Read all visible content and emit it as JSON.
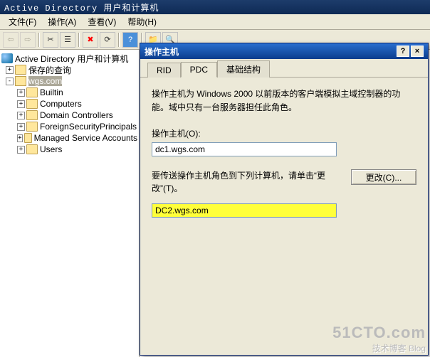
{
  "window": {
    "title": "Active Directory 用户和计算机"
  },
  "menu": {
    "file": "文件(F)",
    "action": "操作(A)",
    "view": "查看(V)",
    "help": "帮助(H)"
  },
  "tree": {
    "root": "Active Directory 用户和计算机",
    "saved": "保存的查询",
    "domain": "wgs.com",
    "nodes": [
      "Builtin",
      "Computers",
      "Domain Controllers",
      "ForeignSecurityPrincipals",
      "Managed Service Accounts",
      "Users"
    ]
  },
  "dialog": {
    "title": "操作主机",
    "help_btn": "?",
    "close_btn": "×",
    "tabs": {
      "rid": "RID",
      "pdc": "PDC",
      "infra": "基础结构"
    },
    "desc": "操作主机为 Windows 2000 以前版本的客户端模拟主域控制器的功能。域中只有一台服务器担任此角色。",
    "current_label": "操作主机(O):",
    "current_value": "dc1.wgs.com",
    "transfer_text": "要传送操作主机角色到下列计算机，请单击“更改”(T)。",
    "change_btn": "更改(C)...",
    "target_value": "DC2.wgs.com"
  },
  "watermark": {
    "site": "51CTO.com",
    "slogan": "技术博客 Blog"
  }
}
